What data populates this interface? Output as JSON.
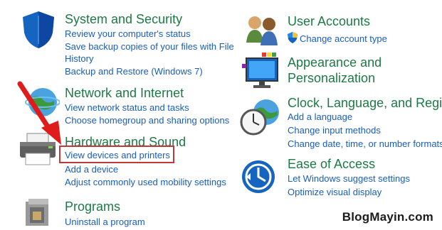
{
  "system_security": {
    "title": "System and Security",
    "links": [
      "Review your computer's status",
      "Save backup copies of your files with File",
      "History",
      "Backup and Restore (Windows 7)"
    ]
  },
  "network_internet": {
    "title": "Network and Internet",
    "links": [
      "View network status and tasks",
      "Choose homegroup and sharing options"
    ]
  },
  "hardware_sound": {
    "title": "Hardware and Sound",
    "links": [
      "View devices and printers",
      "Add a device",
      "Adjust commonly used mobility settings"
    ]
  },
  "programs": {
    "title": "Programs",
    "links": [
      "Uninstall a program"
    ]
  },
  "user_accounts": {
    "title": "User Accounts",
    "links": [
      "Change account type"
    ]
  },
  "appearance": {
    "title_line1": "Appearance and",
    "title_line2": "Personalization"
  },
  "clock_language": {
    "title": "Clock, Language, and Region",
    "links": [
      "Add a language",
      "Change input methods",
      "Change date, time, or number formats"
    ]
  },
  "ease_of_access": {
    "title": "Ease of Access",
    "links": [
      "Let Windows suggest settings",
      "Optimize visual display"
    ]
  },
  "watermark": "BlogMayin.com",
  "colors": {
    "title_green": "#1e7a44",
    "link_blue": "#1a5eb8",
    "highlight_red": "#c0393b"
  }
}
